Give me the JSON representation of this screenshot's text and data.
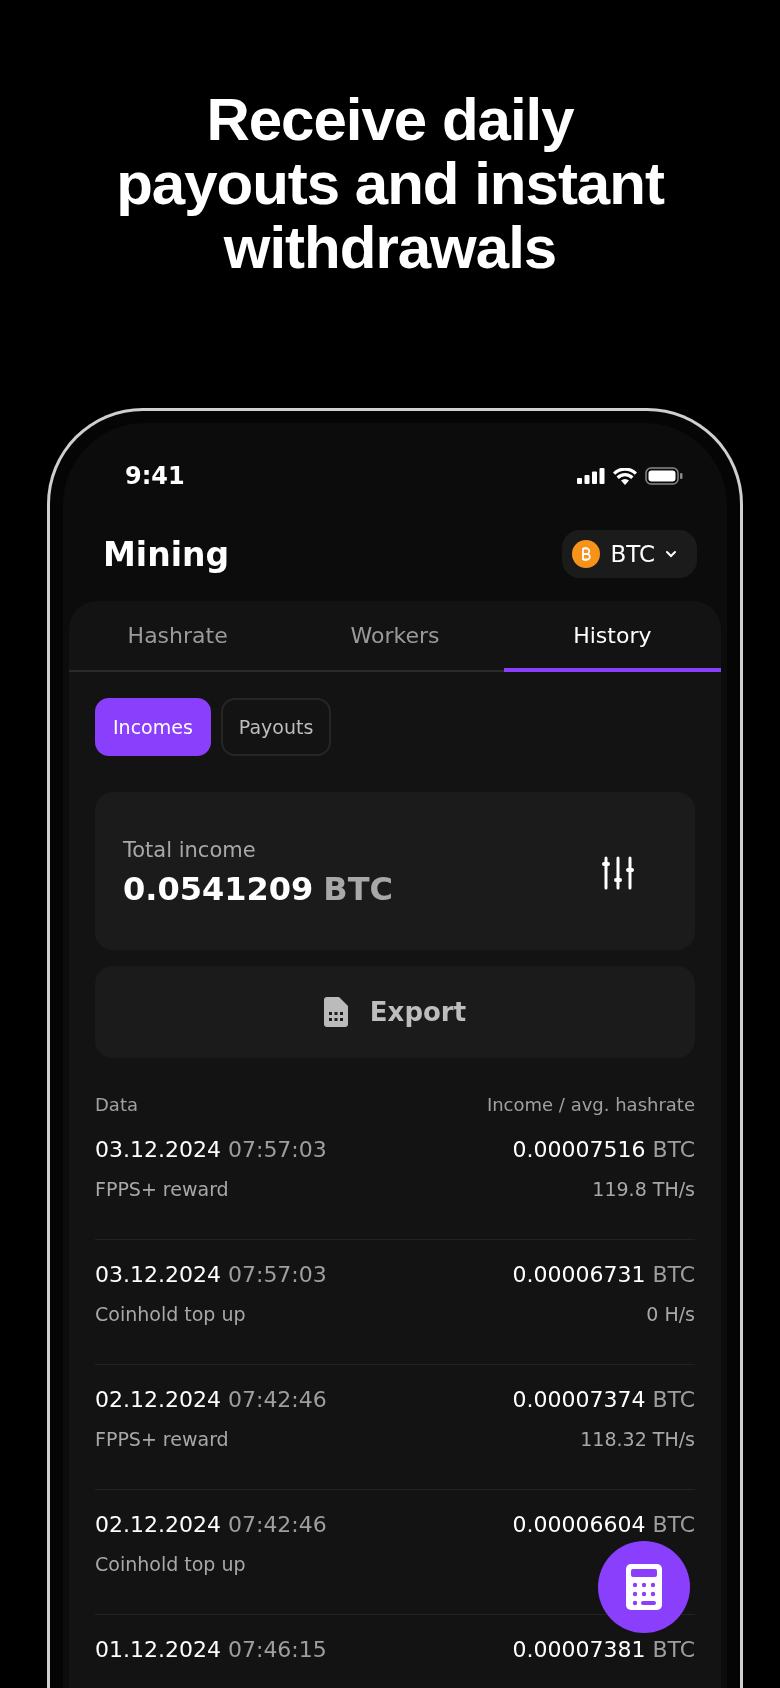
{
  "headline": "Receive daily payouts and instant withdrawals",
  "status_bar": {
    "time": "9:41"
  },
  "header": {
    "title": "Mining",
    "currency": "BTC"
  },
  "tabs": [
    {
      "label": "Hashrate",
      "selected": false
    },
    {
      "label": "Workers",
      "selected": false
    },
    {
      "label": "History",
      "selected": true
    }
  ],
  "segments": [
    {
      "label": "Incomes",
      "selected": true
    },
    {
      "label": "Payouts",
      "selected": false
    }
  ],
  "total": {
    "label": "Total income",
    "amount": "0.0541209",
    "unit": "BTC"
  },
  "export_button": "Export",
  "table": {
    "columns": [
      "Data",
      "Income / avg. hashrate"
    ],
    "rows": [
      {
        "date": "03.12.2024",
        "time": "07:57:03",
        "type": "FPPS+ reward",
        "amount": "0.00007516",
        "unit": "BTC",
        "hashrate": "119.8 TH/s"
      },
      {
        "date": "03.12.2024",
        "time": "07:57:03",
        "type": "Coinhold top up",
        "amount": "0.00006731",
        "unit": "BTC",
        "hashrate": "0 H/s"
      },
      {
        "date": "02.12.2024",
        "time": "07:42:46",
        "type": "FPPS+ reward",
        "amount": "0.00007374",
        "unit": "BTC",
        "hashrate": "118.32 TH/s"
      },
      {
        "date": "02.12.2024",
        "time": "07:42:46",
        "type": "Coinhold top up",
        "amount": "0.00006604",
        "unit": "BTC"
      },
      {
        "date": "01.12.2024",
        "time": "07:46:15",
        "amount": "0.00007381",
        "unit": "BTC"
      }
    ]
  }
}
